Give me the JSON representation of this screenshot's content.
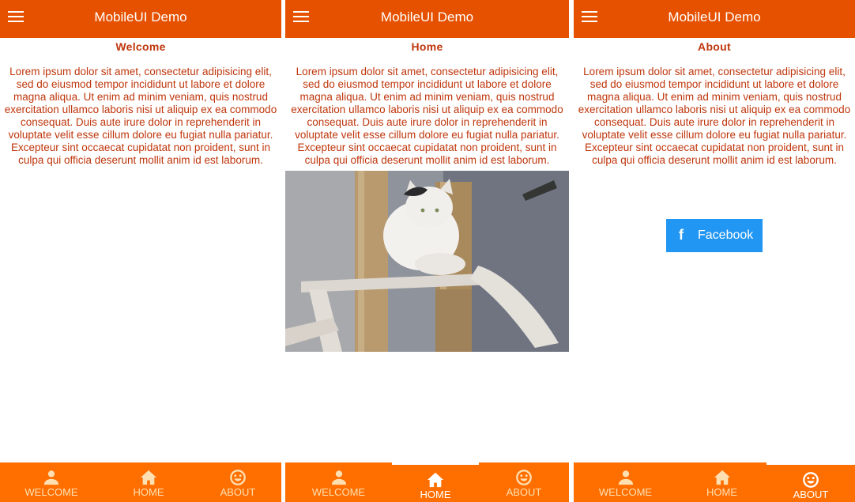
{
  "app_title": "MobileUI Demo",
  "lorem": "Lorem ipsum dolor sit amet, consectetur adipisicing elit, sed do eiusmod tempor incididunt ut labore et dolore magna aliqua. Ut enim ad minim veniam, quis nostrud exercitation ullamco laboris nisi ut aliquip ex ea commodo consequat. Duis aute irure dolor in reprehenderit in voluptate velit esse cillum dolore eu fugiat nulla pariatur. Excepteur sint occaecat cupidatat non proident, sunt in culpa qui officia deserunt mollit anim id est laborum.",
  "screens": [
    {
      "page_title": "Welcome",
      "active_tab": "welcome"
    },
    {
      "page_title": "Home",
      "active_tab": "home"
    },
    {
      "page_title": "About",
      "active_tab": "about"
    }
  ],
  "facebook": {
    "icon": "f",
    "label": "Facebook"
  },
  "tabs": [
    {
      "label": "WELCOME",
      "icon": "person-icon"
    },
    {
      "label": "HOME",
      "icon": "home-icon"
    },
    {
      "label": "ABOUT",
      "icon": "smiley-icon"
    }
  ],
  "colors": {
    "app_bar": "#e65100",
    "tab_bar": "#ff6f00",
    "text": "#bf360c",
    "facebook": "#2196f3"
  }
}
